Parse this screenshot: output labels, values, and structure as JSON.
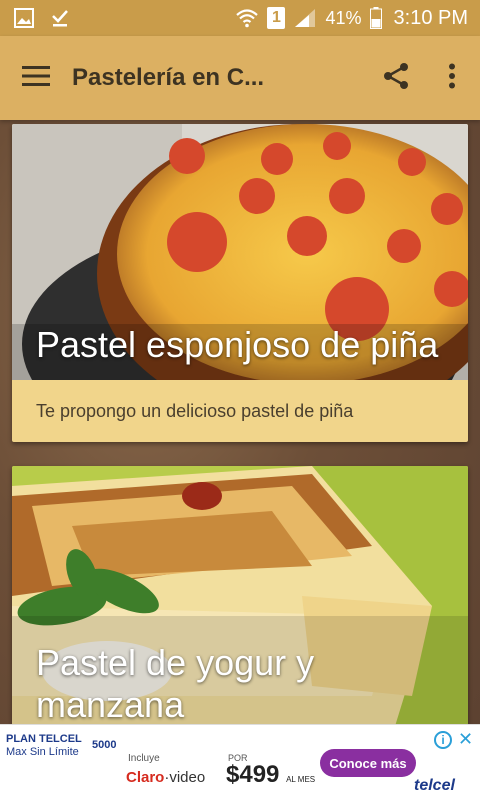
{
  "status_bar": {
    "battery_percent": "41%",
    "time": "3:10 PM",
    "notification_badge": "1",
    "icons": [
      "image-notification-icon",
      "download-done-icon",
      "wifi-icon",
      "sim-badge-icon",
      "signal-icon",
      "battery-icon"
    ]
  },
  "app_bar": {
    "title": "Pastelería en C...",
    "menu_icon": "hamburger-menu-icon",
    "share_icon": "share-icon",
    "more_icon": "more-vert-icon"
  },
  "cards": [
    {
      "title": "Pastel esponjoso de piña",
      "description": "Te propongo un delicioso pastel de piña"
    },
    {
      "title": "Pastel de yogur y manzana",
      "description": ""
    }
  ],
  "ad": {
    "plan": "PLAN TELCEL",
    "plan_sub": "Max Sin Límite",
    "amount": "5000",
    "incluye": "Incluye",
    "claro": "Claro",
    "video": "video",
    "por": "POR",
    "price": "$499",
    "price_suffix": "AL MES",
    "cta": "Conoce más",
    "brand": "telcel"
  },
  "colors": {
    "status_bar": "#c99c4a",
    "app_bar": "#dcb062",
    "card_footer": "#f1d58b",
    "title_text": "#3d3322"
  }
}
